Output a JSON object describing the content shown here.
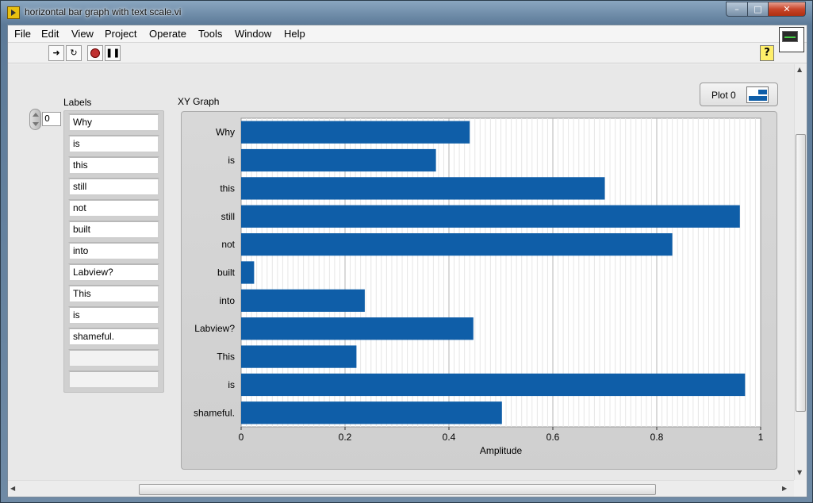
{
  "window": {
    "title": "horizontal bar graph with text scale.vi"
  },
  "menu": [
    "File",
    "Edit",
    "View",
    "Project",
    "Operate",
    "Tools",
    "Window",
    "Help"
  ],
  "toolbar": {
    "run_icon": "run-arrow-icon",
    "run_continuous_icon": "run-continuously-icon",
    "abort_icon": "abort-stop-icon",
    "pause_icon": "pause-icon",
    "help_label": "?"
  },
  "labels_control": {
    "caption": "Labels",
    "index_value": "0",
    "items": [
      "Why",
      "is",
      "this",
      "still",
      "not",
      "built",
      "into",
      "Labview?",
      "This",
      "is",
      "shameful.",
      "",
      ""
    ]
  },
  "graph": {
    "caption": "XY Graph",
    "legend_plot": "Plot 0"
  },
  "chart_data": {
    "type": "bar",
    "orientation": "horizontal",
    "categories": [
      "Why",
      "is",
      "this",
      "still",
      "not",
      "built",
      "into",
      "Labview?",
      "This",
      "is",
      "shameful."
    ],
    "values": [
      0.44,
      0.375,
      0.7,
      0.96,
      0.83,
      0.025,
      0.238,
      0.447,
      0.222,
      0.97,
      0.502
    ],
    "series": [
      {
        "name": "Plot 0"
      }
    ],
    "xlabel": "Amplitude",
    "xlim": [
      0,
      1
    ],
    "xticks": [
      "0",
      "0.2",
      "0.4",
      "0.6",
      "0.8",
      "1"
    ],
    "bar_color": "#0f5ea8",
    "grid": true,
    "legend": "top-right"
  }
}
